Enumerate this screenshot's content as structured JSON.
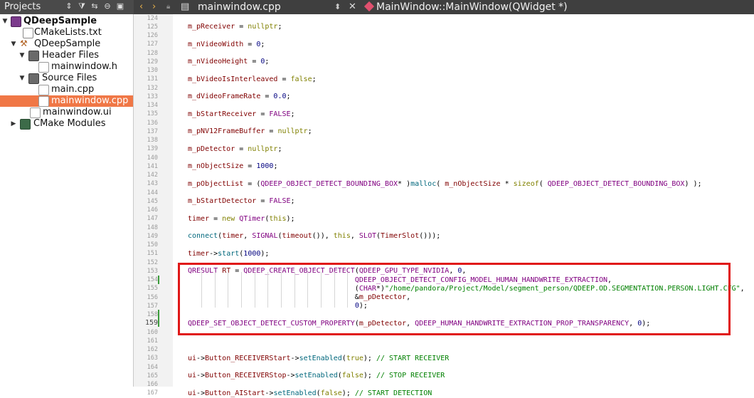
{
  "projects_panel": {
    "title": "Projects",
    "tree": [
      {
        "label": "QDeepSample",
        "bold": true
      },
      {
        "label": "CMakeLists.txt"
      },
      {
        "label": "QDeepSample"
      },
      {
        "label": "Header Files"
      },
      {
        "label": "mainwindow.h"
      },
      {
        "label": "Source Files"
      },
      {
        "label": "main.cpp"
      },
      {
        "label": "mainwindow.cpp",
        "selected": true
      },
      {
        "label": "mainwindow.ui"
      },
      {
        "label": "CMake Modules"
      }
    ]
  },
  "editor": {
    "file_name": "mainwindow.cpp",
    "symbol": "MainWindow::MainWindow(QWidget *)",
    "current_line": "159",
    "lines": [
      {
        "n": "124",
        "t": ""
      },
      {
        "n": "125",
        "t": "m_pReceiver = nullptr;"
      },
      {
        "n": "126",
        "t": ""
      },
      {
        "n": "127",
        "t": "m_nVideoWidth = 0;"
      },
      {
        "n": "128",
        "t": ""
      },
      {
        "n": "129",
        "t": "m_nVideoHeight = 0;"
      },
      {
        "n": "130",
        "t": ""
      },
      {
        "n": "131",
        "t": "m_bVideoIsInterleaved = false;"
      },
      {
        "n": "132",
        "t": ""
      },
      {
        "n": "133",
        "t": "m_dVideoFrameRate = 0.0;"
      },
      {
        "n": "134",
        "t": ""
      },
      {
        "n": "135",
        "t": "m_bStartReceiver = FALSE;"
      },
      {
        "n": "136",
        "t": ""
      },
      {
        "n": "137",
        "t": "m_pNV12FrameBuffer = nullptr;"
      },
      {
        "n": "138",
        "t": ""
      },
      {
        "n": "139",
        "t": "m_pDetector = nullptr;"
      },
      {
        "n": "140",
        "t": ""
      },
      {
        "n": "141",
        "t": "m_nObjectSize = 1000;"
      },
      {
        "n": "142",
        "t": ""
      },
      {
        "n": "143",
        "t": "m_pObjectList = (QDEEP_OBJECT_DETECT_BOUNDING_BOX* )malloc( m_nObjectSize * sizeof( QDEEP_OBJECT_DETECT_BOUNDING_BOX) );"
      },
      {
        "n": "144",
        "t": ""
      },
      {
        "n": "145",
        "t": "m_bStartDetector = FALSE;"
      },
      {
        "n": "146",
        "t": ""
      },
      {
        "n": "147",
        "t": "timer = new QTimer(this);"
      },
      {
        "n": "148",
        "t": ""
      },
      {
        "n": "149",
        "t": "connect(timer, SIGNAL(timeout()), this, SLOT(TimerSlot()));"
      },
      {
        "n": "150",
        "t": ""
      },
      {
        "n": "151",
        "t": "timer->start(1000);"
      },
      {
        "n": "152",
        "t": ""
      },
      {
        "n": "153",
        "t": "QRESULT RT = QDEEP_CREATE_OBJECT_DETECT(QDEEP_GPU_TYPE_NVIDIA, 0,"
      },
      {
        "n": "154",
        "t": "                                       QDEEP_OBJECT_DETECT_CONFIG_MODEL_HUMAN_HANDWRITE_EXTRACTION,"
      },
      {
        "n": "155",
        "t": "                                       (CHAR*)\"/home/pandora/Project/Model/segment_person/QDEEP.OD.SEGMENTATION.PERSON.LIGHT.CFG\","
      },
      {
        "n": "156",
        "t": "                                       &m_pDetector,"
      },
      {
        "n": "157",
        "t": "                                       0);"
      },
      {
        "n": "158",
        "t": ""
      },
      {
        "n": "159",
        "t": "QDEEP_SET_OBJECT_DETECT_CUSTOM_PROPERTY(m_pDetector, QDEEP_HUMAN_HANDWRITE_EXTRACTION_PROP_TRANSPARENCY, 0);"
      },
      {
        "n": "160",
        "t": ""
      },
      {
        "n": "161",
        "t": ""
      },
      {
        "n": "162",
        "t": ""
      },
      {
        "n": "163",
        "t": "ui->Button_RECEIVERStart->setEnabled(true); // START RECEIVER"
      },
      {
        "n": "164",
        "t": ""
      },
      {
        "n": "165",
        "t": "ui->Button_RECEIVERStop->setEnabled(false); // STOP RECEIVER"
      },
      {
        "n": "166",
        "t": ""
      },
      {
        "n": "167",
        "t": "ui->Button_AIStart->setEnabled(false); // START DETECTION"
      }
    ]
  },
  "colors": {
    "selection": "#f07746",
    "highlight_box": "#e01818",
    "toolbar_bg": "#3f3f3f"
  }
}
